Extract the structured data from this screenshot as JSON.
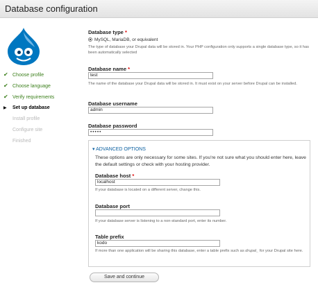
{
  "page": {
    "title": "Database configuration"
  },
  "logo": {
    "name": "drupal-drop-logo",
    "color": "#0077c0"
  },
  "steps": [
    {
      "label": "Choose profile",
      "status": "done",
      "mark": "✔"
    },
    {
      "label": "Choose language",
      "status": "done",
      "mark": "✔"
    },
    {
      "label": "Verify requirements",
      "status": "done",
      "mark": "✔"
    },
    {
      "label": "Set up database",
      "status": "active",
      "mark": "▶"
    },
    {
      "label": "Install profile",
      "status": "todo",
      "mark": ""
    },
    {
      "label": "Configure site",
      "status": "todo",
      "mark": ""
    },
    {
      "label": "Finished",
      "status": "todo",
      "mark": ""
    }
  ],
  "db_type": {
    "label": "Database type",
    "required": "*",
    "option": "MySQL, MariaDB, or equivalent",
    "help": "The type of database your Drupal data will be stored in. Your PHP configuration only supports a single database type, so it has been automatically selected"
  },
  "db_name": {
    "label": "Database name",
    "required": "*",
    "value": "test",
    "help": "The name of the database your Drupal data will be stored in. It must exist on your server before Drupal can be installed."
  },
  "db_user": {
    "label": "Database username",
    "value": "admin"
  },
  "db_pass": {
    "label": "Database password",
    "value": "•••••"
  },
  "advanced": {
    "legend": "▾ ADVANCED OPTIONS",
    "intro": "These options are only necessary for some sites. If you're not sure what you should enter here, leave the default settings or check with your hosting provider.",
    "host": {
      "label": "Database host",
      "required": "*",
      "value": "localhost",
      "help": "If your database is located on a different server, change this."
    },
    "port": {
      "label": "Database port",
      "value": "",
      "help": "If your database server is listening to a non-standard port, enter its number."
    },
    "prefix": {
      "label": "Table prefix",
      "value": "kodo",
      "help_before": "If more than one application will be sharing this database, enter a table prefix such as ",
      "help_em": "drupal_",
      "help_after": " for your Drupal site here."
    }
  },
  "submit": {
    "label": "Save and continue"
  },
  "colors": {
    "done": "#3b7f1b",
    "link": "#0a5fa0",
    "required": "#dd0000"
  }
}
